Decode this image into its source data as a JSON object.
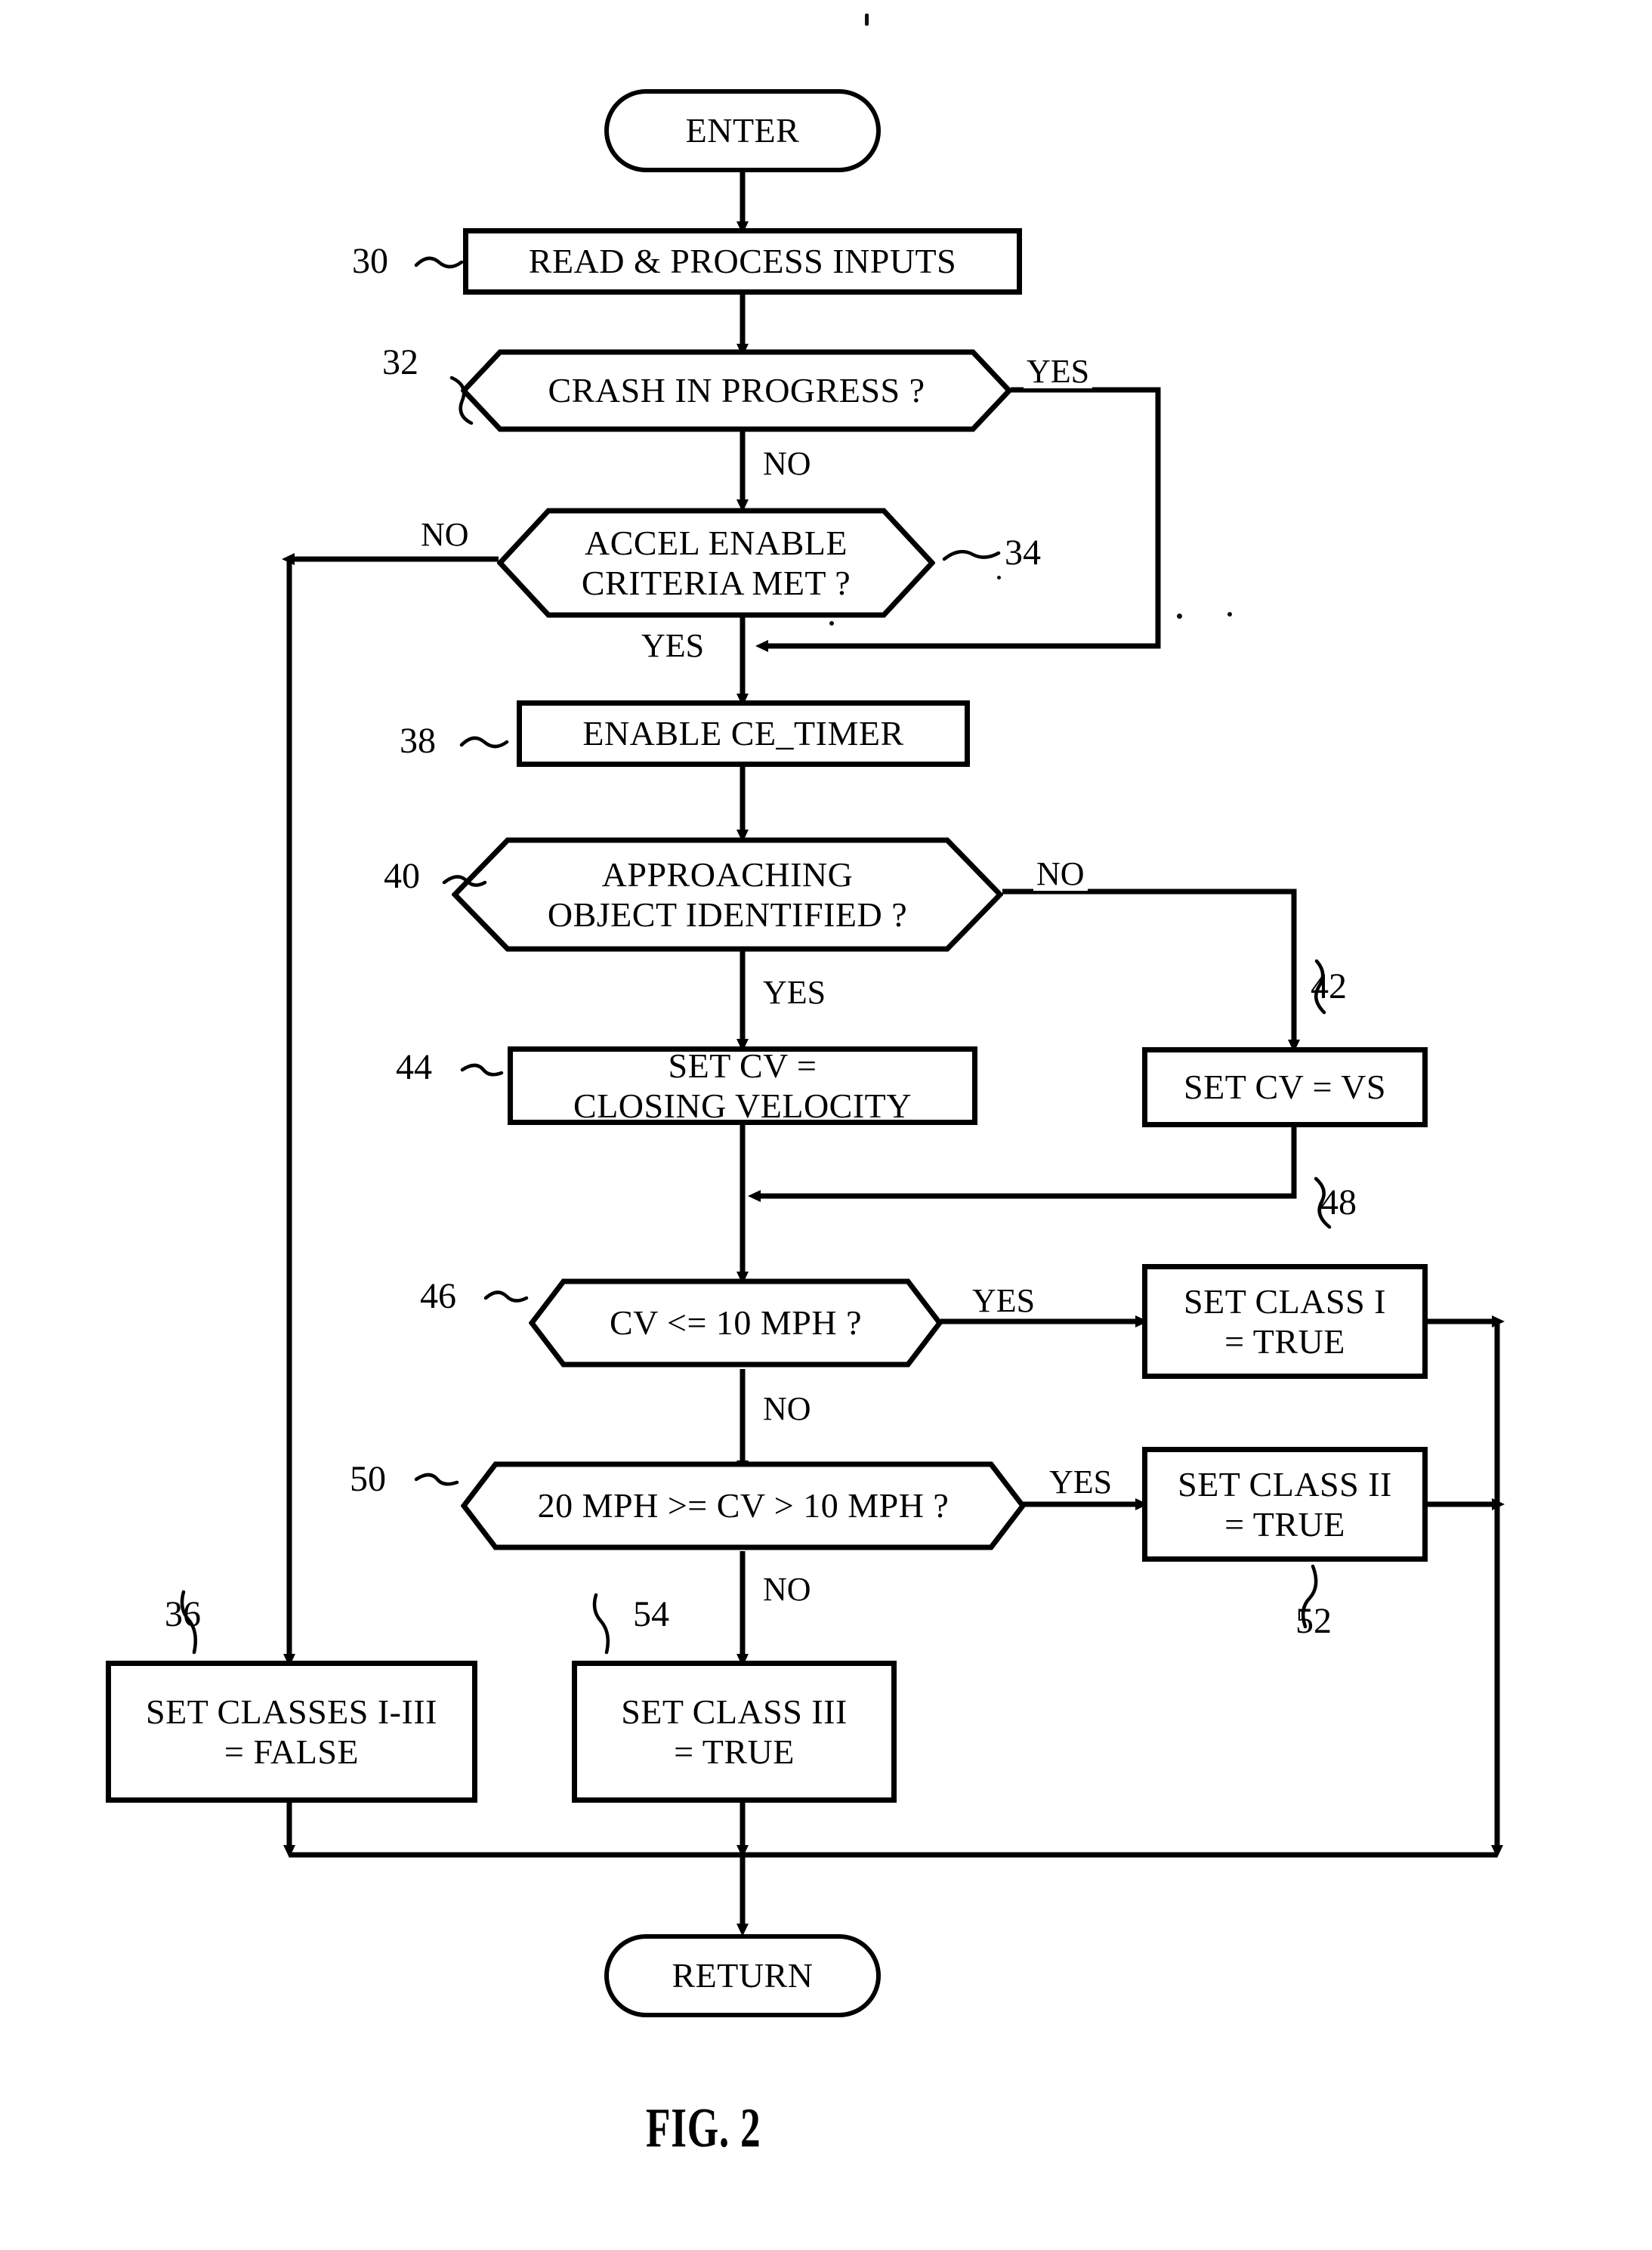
{
  "figure": {
    "caption": "FIG. 2",
    "title": "Crash classification control routine flowchart"
  },
  "nodes": {
    "enter": {
      "ref": "",
      "label": "ENTER",
      "shape": "terminal"
    },
    "read": {
      "ref": "30",
      "label": "READ & PROCESS INPUTS",
      "shape": "process"
    },
    "crash": {
      "ref": "32",
      "label": "CRASH IN PROGRESS ?",
      "shape": "decision"
    },
    "accel": {
      "ref": "34",
      "label": "ACCEL ENABLE\nCRITERIA MET ?",
      "shape": "decision"
    },
    "timer": {
      "ref": "38",
      "label": "ENABLE CE_TIMER",
      "shape": "process"
    },
    "approach": {
      "ref": "40",
      "label": "APPROACHING\nOBJECT IDENTIFIED ?",
      "shape": "decision"
    },
    "cv_vs": {
      "ref": "42",
      "label": "SET CV = VS",
      "shape": "process"
    },
    "cv_close": {
      "ref": "44",
      "label": "SET CV =\nCLOSING VELOCITY",
      "shape": "process"
    },
    "cv10": {
      "ref": "46",
      "label": "CV <= 10 MPH ?",
      "shape": "decision"
    },
    "class1": {
      "ref": "48",
      "label": "SET CLASS I\n= TRUE",
      "shape": "process"
    },
    "cv20": {
      "ref": "50",
      "label": "20 MPH >= CV > 10 MPH ?",
      "shape": "decision"
    },
    "class2": {
      "ref": "52",
      "label": "SET CLASS II\n= TRUE",
      "shape": "process"
    },
    "false_all": {
      "ref": "36",
      "label": "SET CLASSES I-III\n= FALSE",
      "shape": "process"
    },
    "class3": {
      "ref": "54",
      "label": "SET CLASS III\n= TRUE",
      "shape": "process"
    },
    "return": {
      "ref": "",
      "label": "RETURN",
      "shape": "terminal"
    }
  },
  "branch_labels": {
    "crash_yes": "YES",
    "crash_no": "NO",
    "accel_no": "NO",
    "accel_yes": "YES",
    "approach_no": "NO",
    "approach_yes": "YES",
    "cv10_yes": "YES",
    "cv10_no": "NO",
    "cv20_yes": "YES",
    "cv20_no": "NO"
  },
  "reference_numerals": [
    "30",
    "32",
    "34",
    "36",
    "38",
    "40",
    "42",
    "44",
    "46",
    "48",
    "50",
    "52",
    "54"
  ],
  "colors": {
    "ink": "#000000",
    "paper": "#ffffff"
  }
}
